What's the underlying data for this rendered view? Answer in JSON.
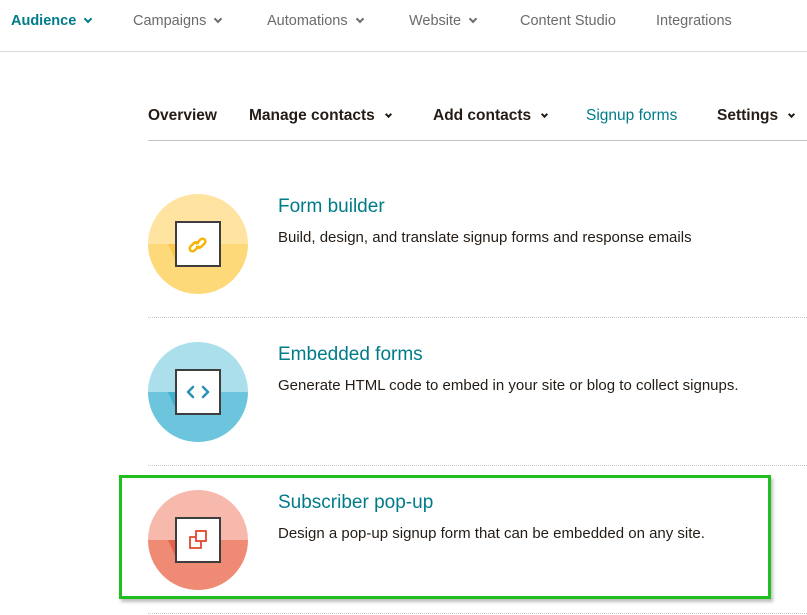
{
  "top_nav": {
    "items": [
      {
        "label": "Audience",
        "has_dropdown": true,
        "active": true
      },
      {
        "label": "Campaigns",
        "has_dropdown": true,
        "active": false
      },
      {
        "label": "Automations",
        "has_dropdown": true,
        "active": false
      },
      {
        "label": "Website",
        "has_dropdown": true,
        "active": false
      },
      {
        "label": "Content Studio",
        "has_dropdown": false,
        "active": false
      },
      {
        "label": "Integrations",
        "has_dropdown": false,
        "active": false
      }
    ]
  },
  "sub_nav": {
    "items": [
      {
        "label": "Overview",
        "has_dropdown": false,
        "active": false
      },
      {
        "label": "Manage contacts",
        "has_dropdown": true,
        "active": false
      },
      {
        "label": "Add contacts",
        "has_dropdown": true,
        "active": false
      },
      {
        "label": "Signup forms",
        "has_dropdown": false,
        "active": true
      },
      {
        "label": "Settings",
        "has_dropdown": true,
        "active": false
      }
    ]
  },
  "form_options": [
    {
      "title": "Form builder",
      "description": "Build, design, and translate signup forms and response emails",
      "icon": "link-icon",
      "colors": {
        "top": "#ffe3a0",
        "bottom": "#fed97a",
        "wedge": "#fdc84a",
        "glyph": "#f6b400"
      }
    },
    {
      "title": "Embedded forms",
      "description": "Generate HTML code to embed in your site or blog to collect signups.",
      "icon": "code-brackets-icon",
      "colors": {
        "top": "#aadfeb",
        "bottom": "#6cc5dc",
        "wedge": "#43b2d2",
        "glyph": "#2d93b6"
      }
    },
    {
      "title": "Subscriber pop-up",
      "description": "Design a pop-up signup form that can be embedded on any site.",
      "icon": "popup-windows-icon",
      "colors": {
        "top": "#f6b9ab",
        "bottom": "#ef8b74",
        "wedge": "#e8624a",
        "glyph": "#e2472b"
      },
      "highlighted": true
    }
  ],
  "highlight_color": "#1fbf1f",
  "accent_color": "#007c89"
}
